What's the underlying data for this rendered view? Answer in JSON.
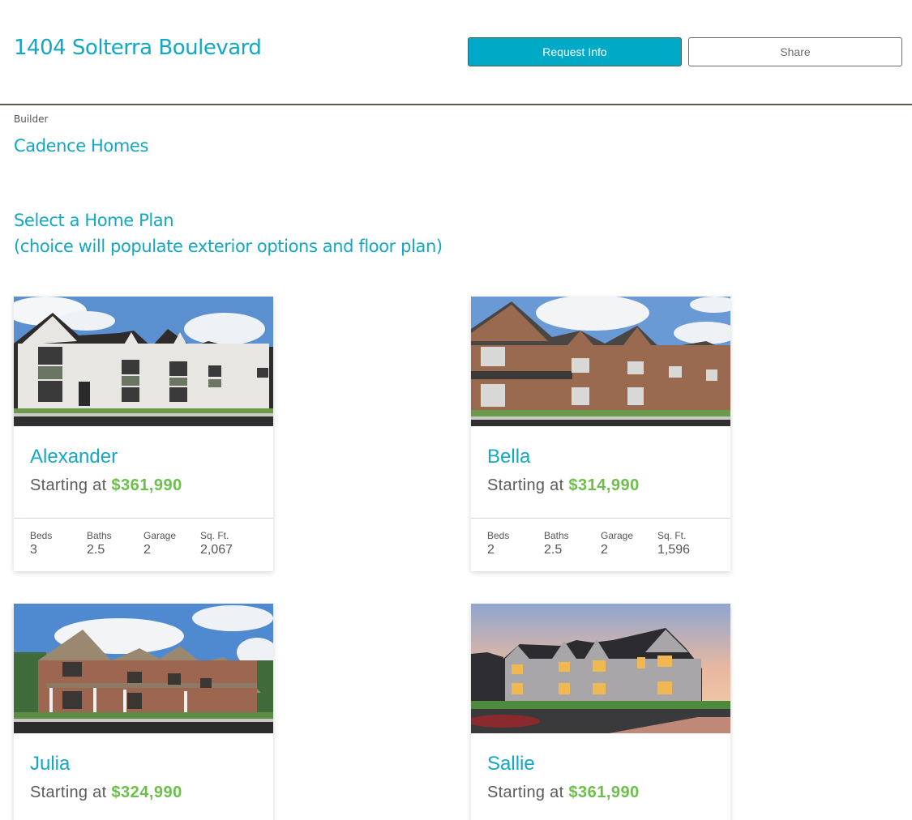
{
  "header": {
    "title": "1404 Solterra Boulevard",
    "request_info_label": "Request Info",
    "share_label": "Share"
  },
  "builder": {
    "label": "Builder",
    "name": "Cadence Homes"
  },
  "plans_section": {
    "title_line1": "Select a Home Plan",
    "title_line2": "(choice will populate exterior options and floor plan)"
  },
  "colors": {
    "accent": "#13a7c4",
    "button": "#00aac6",
    "price": "#6cc04a",
    "divider": "#5e5a52"
  },
  "spec_labels": {
    "beds": "Beds",
    "baths": "Baths",
    "garage": "Garage",
    "sqft": "Sq. Ft."
  },
  "plans": [
    {
      "name": "Alexander",
      "starting_label": "Starting at",
      "price": "$361,990",
      "beds": "3",
      "baths": "2.5",
      "garage": "2",
      "sqft": "2,067",
      "image": "white-brick-townhomes-photo"
    },
    {
      "name": "Bella",
      "starting_label": "Starting at",
      "price": "$314,990",
      "beds": "2",
      "baths": "2.5",
      "garage": "2",
      "sqft": "1,596",
      "image": "red-brick-townhomes-photo"
    },
    {
      "name": "Julia",
      "starting_label": "Starting at",
      "price": "$324,990",
      "image": "brick-townhomes-with-porches-photo"
    },
    {
      "name": "Sallie",
      "starting_label": "Starting at",
      "price": "$361,990",
      "image": "stone-townhomes-at-dusk-photo"
    }
  ]
}
